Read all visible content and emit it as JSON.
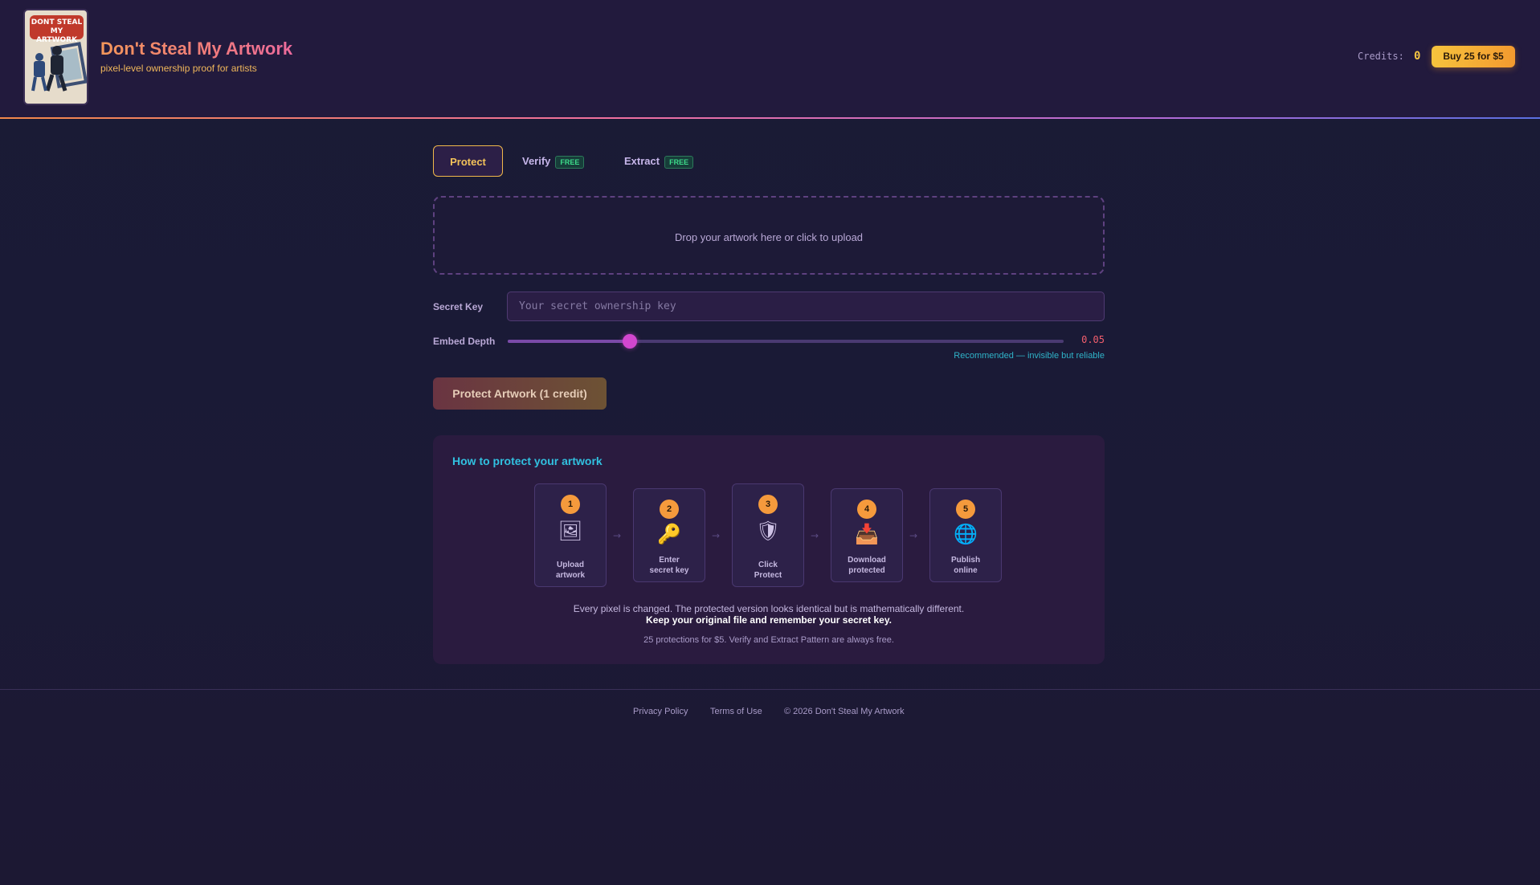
{
  "header": {
    "logo_text": "DONT STEAL MY ARTWORK",
    "title": "Don't Steal My Artwork",
    "subtitle": "pixel-level ownership proof for artists",
    "credits_label": "Credits:",
    "credits_value": "0",
    "buy_button": "Buy 25 for $5"
  },
  "tabs": [
    {
      "label": "Protect",
      "active": true
    },
    {
      "label": "Verify",
      "badge": "FREE"
    },
    {
      "label": "Extract",
      "badge": "FREE"
    }
  ],
  "dropzone": {
    "text": "Drop your artwork here or click to upload"
  },
  "secret_key": {
    "label": "Secret Key",
    "placeholder": "Your secret ownership key",
    "value": ""
  },
  "embed_depth": {
    "label": "Embed Depth",
    "value": "0.05",
    "fraction": 0.22,
    "hint": "Recommended — invisible but reliable"
  },
  "protect_button": "Protect Artwork (1 credit)",
  "howto": {
    "title": "How to protect your artwork",
    "steps": [
      {
        "num": "1",
        "icon": "image-icon",
        "glyph": "🖼",
        "label_line1": "Upload",
        "label_line2": "artwork"
      },
      {
        "num": "2",
        "icon": "key-icon",
        "glyph": "🔑",
        "label_line1": "Enter",
        "label_line2": "secret key"
      },
      {
        "num": "3",
        "icon": "shield-icon",
        "glyph": "🛡",
        "label_line1": "Click",
        "label_line2": "Protect"
      },
      {
        "num": "4",
        "icon": "download-tray-icon",
        "glyph": "📥",
        "label_line1": "Download",
        "label_line2": "protected"
      },
      {
        "num": "5",
        "icon": "globe-icon",
        "glyph": "🌐",
        "label_line1": "Publish",
        "label_line2": "online"
      }
    ],
    "arrow": "→",
    "line1": "Every pixel is changed. The protected version looks identical but is mathematically different.",
    "line2": "Keep your original file and remember your secret key.",
    "line3": "25 protections for $5. Verify and Extract Pattern are always free."
  },
  "footer": {
    "privacy": "Privacy Policy",
    "terms": "Terms of Use",
    "copyright": "© 2026 Don't Steal My Artwork"
  },
  "colors": {
    "accent_orange": "#f59a3c",
    "accent_yellow": "#f5c542",
    "accent_teal": "#31c1e0",
    "slider_thumb": "#d247cf",
    "free_green": "#3ddc8a"
  }
}
